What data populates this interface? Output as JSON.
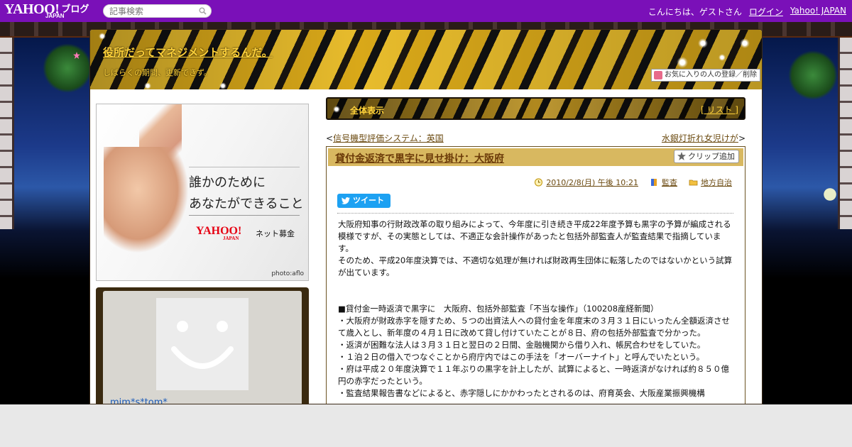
{
  "topbar": {
    "logo_text": "YAHOO!",
    "logo_sub": "JAPAN",
    "logo_blog": "ブログ",
    "search_placeholder": "記事検索",
    "greeting": "こんにちは、ゲストさん",
    "login": "ログイン",
    "yahoo_japan": "Yahoo! JAPAN"
  },
  "header": {
    "blog_title": "役所だってマネジメントするんだ。",
    "blog_description": "しばらくの期間、更新できず。",
    "favorite_button": "お気に入りの人の登録／削除"
  },
  "sidebar": {
    "banner": {
      "line1": "誰かのために",
      "line2": "あなたができること",
      "brand": "YAHOO!",
      "brand_sub": "JAPAN",
      "campaign": "ネット募金",
      "credit": "photo:aflo"
    },
    "profile": {
      "name": "mim*s*tom*"
    }
  },
  "main": {
    "all_view_label": "全体表示",
    "list_label": "[ リスト ]",
    "prev_link": "信号機型評価システム：英国",
    "next_link": "水銀灯折れ女児けが",
    "article": {
      "title": "貸付金返済で黒字に見せ掛け：大阪府",
      "clip_button": "クリップ追加",
      "date": "2010/2/8(月) 午後 10:21",
      "category1": "監査",
      "category2": "地方自治",
      "tweet_button": "ツイート",
      "paragraphs": [
        "大阪府知事の行財政改革の取り組みによって、今年度に引き続き平成22年度予算も黒字の予算が編成される模様ですが、その実態としては、不適正な会計操作があったと包括外部監査人が監査結果で指摘しています。",
        "そのため、平成20年度決算では、不適切な処理が無ければ財政再生団体に転落したのではないかという試算が出ています。"
      ],
      "quote_title": "■貸付金一時返済で黒字に　大阪府、包括外部監査「不当な操作」（100208産経新聞）",
      "bullets": [
        "・大阪府が財政赤字を隠すため、５つの出資法人への貸付金を年度末の３月３１日にいったん全額返済させて歳入とし、新年度の４月１日に改めて貸し付けていたことが８日、府の包括外部監査で分かった。",
        "・返済が困難な法人は３月３１日と翌日の２日間、金融機関から借り入れ、帳尻合わせをしていた。",
        "・１泊２日の借入でつなぐことから府庁内ではこの手法を「オーバーナイト」と呼んでいたという。",
        "・府は平成２０年度決算で１１年ぶりの黒字を計上したが、試算によると、一時返済がなければ約８５０億円の赤字だったという。",
        "・監査結果報告書などによると、赤字隠しにかかわったとされるのは、府育英会、大阪産業振興機構"
      ]
    }
  },
  "colors": {
    "topbar": "#7a10b8",
    "gold_text": "#ffd23a",
    "link_brown": "#6b4a10",
    "title_bar": "#d8b860",
    "tweet": "#1da1f2"
  }
}
